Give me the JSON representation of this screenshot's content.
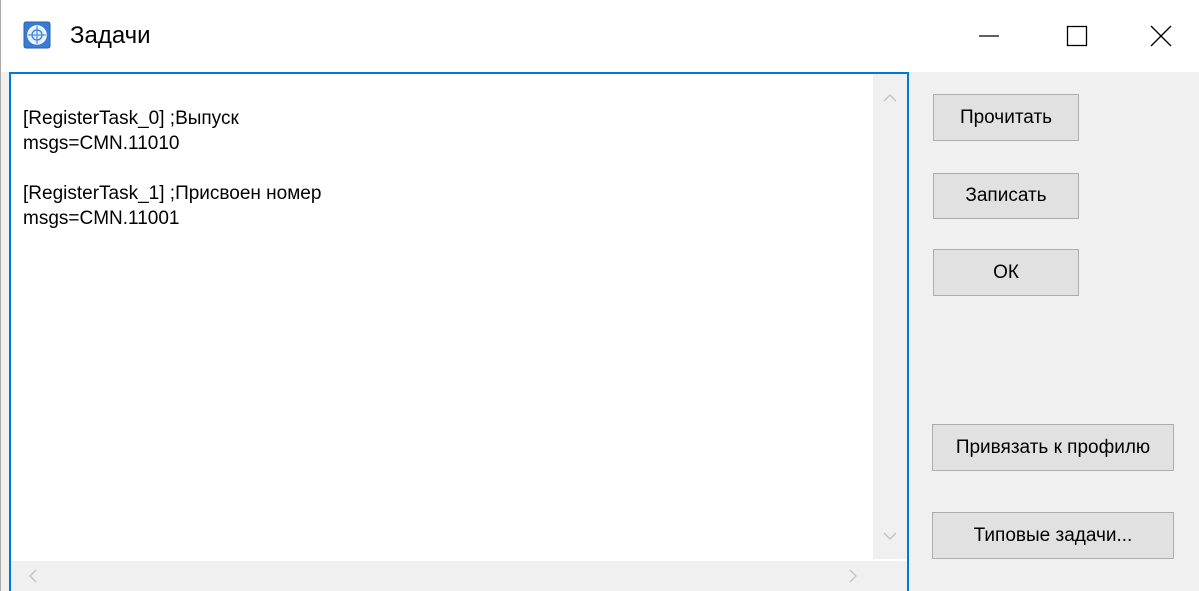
{
  "window": {
    "title": "Задачи",
    "icon": "app-globe-icon",
    "controls": {
      "minimize": "minimize-icon",
      "maximize": "maximize-icon",
      "close": "close-icon"
    }
  },
  "editor": {
    "text": "[RegisterTask_0] ;Выпуск\nmsgs=CMN.11010\n\n[RegisterTask_1] ;Присвоен номер\nmsgs=CMN.11001",
    "border_color": "#0078d7"
  },
  "buttons": {
    "read": "Прочитать",
    "write": "Записать",
    "ok": "ОК",
    "bind_profile": "Привязать к профилю",
    "typical_tasks": "Типовые задачи..."
  }
}
